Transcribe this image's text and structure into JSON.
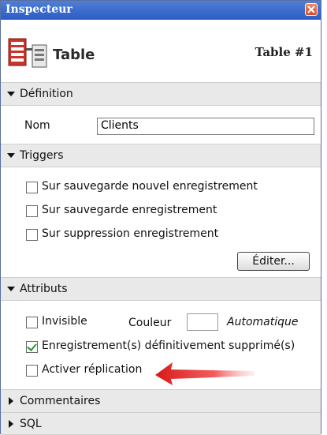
{
  "window": {
    "title": "Inspecteur"
  },
  "header": {
    "name": "Table",
    "number": "Table #1",
    "icon": "table-icon"
  },
  "sections": {
    "definition": {
      "label": "Définition",
      "name_label": "Nom",
      "name_value": "Clients"
    },
    "triggers": {
      "label": "Triggers",
      "items": [
        {
          "label": "Sur sauvegarde nouvel enregistrement",
          "checked": false
        },
        {
          "label": "Sur sauvegarde enregistrement",
          "checked": false
        },
        {
          "label": "Sur suppression enregistrement",
          "checked": false
        }
      ],
      "edit_button": "Éditer..."
    },
    "attributes": {
      "label": "Attributs",
      "invisible": {
        "label": "Invisible",
        "checked": false
      },
      "color_label": "Couleur",
      "color_value": "Automatique",
      "permanent_delete": {
        "label": "Enregistrement(s) définitivement supprimé(s)",
        "checked": true
      },
      "replication": {
        "label": "Activer réplication",
        "checked": false
      }
    },
    "comments": {
      "label": "Commentaires"
    },
    "sql": {
      "label": "SQL"
    }
  },
  "colors": {
    "titlebar": "#2b5cc4",
    "section_header": "#e9e9e9",
    "arrow": "#e02020",
    "check": "#1f9a2c"
  }
}
